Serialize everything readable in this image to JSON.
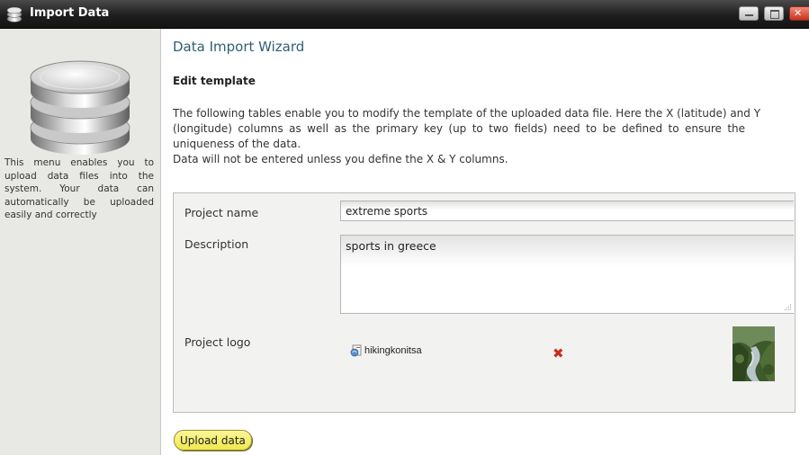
{
  "window": {
    "title": "Import Data",
    "icon": "database-icon",
    "controls": {
      "minimize": "minimize-icon",
      "maximize": "maximize-icon",
      "close": "close-icon"
    }
  },
  "sidebar": {
    "icon": "database-icon",
    "description": "This menu enables you to upload data files into the system. Your data can automatically be uploaded easily and correctly"
  },
  "main": {
    "wizard_title": "Data Import Wizard",
    "section_title": "Edit template",
    "intro_lines": [
      "The following tables enable you to modify the template of the uploaded data file. Here the X (latitude) and Y",
      "(longitude) columns as well as the primary key (up to two fields) need to be defined to ensure the",
      "uniqueness of the data.",
      "Data will not be entered unless you define the X & Y columns."
    ]
  },
  "form": {
    "project_name": {
      "label": "Project name",
      "value": "extreme sports"
    },
    "description": {
      "label": "Description",
      "value": "sports in greece"
    },
    "project_logo": {
      "label": "Project logo",
      "file_name": "hikingkonitsa",
      "remove_icon": "remove-icon"
    }
  },
  "actions": {
    "upload_label": "Upload data"
  },
  "colors": {
    "accent_title": "#2f5f73",
    "upload_button": "#f1e84e",
    "remove": "#cc2b1a",
    "titlebar": "#1e1e1e"
  }
}
